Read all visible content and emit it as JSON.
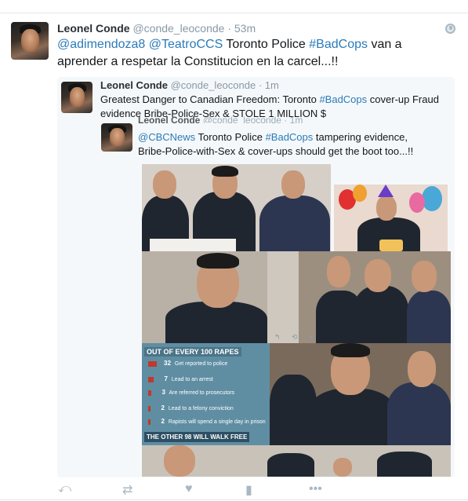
{
  "tweet": {
    "author_name": "Leonel Conde",
    "author_handle": "@conde_leoconde",
    "separator": "·",
    "timestamp": "53m",
    "mention_1": "@adimendoza8",
    "mention_2": "@TeatroCCS",
    "text_part_1": "Toronto Police",
    "hashtag": "#BadCops",
    "text_part_2": "van a aprender a respetar la Constitucion  en la carcel...!!",
    "privacy_icon": "globe-icon"
  },
  "quote_1": {
    "author_name": "Leonel Conde",
    "author_handle": "@conde_leoconde",
    "separator": "·",
    "timestamp": "1m",
    "text_part_1": "Greatest Danger to Canadian Freedom: Toronto",
    "hashtag": "#BadCops",
    "text_part_2": "cover-up Fraud evidence Bribe-Police-Sex & STOLE 1 MILLION $"
  },
  "quote_2": {
    "author_name": "Leonel Conde",
    "author_handle": "@conde_leoconde",
    "separator": "·",
    "timestamp": "1m",
    "mention": "@CBCNews",
    "text_part_1": "Toronto Police",
    "hashtag": "#BadCops",
    "text_part_2": "tampering evidence, Bribe-Police-with-Sex & cover-ups should get the boot too...!!"
  },
  "infographic": {
    "title": "OUT OF EVERY 100 RAPES",
    "rows": [
      {
        "num": "32",
        "label": "Get reported to police",
        "fraction": 0.78
      },
      {
        "num": "7",
        "label": "Lead to an arrest",
        "fraction": 0.5
      },
      {
        "num": "3",
        "label": "Are referred to prosecutors",
        "fraction": 0.3
      },
      {
        "num": "2",
        "label": "Lead to a felony conviction",
        "fraction": 0.2
      },
      {
        "num": "2",
        "label": "Rapists will spend a single day in prison",
        "fraction": 0.2
      }
    ],
    "footer": "THE OTHER 98 WILL WALK FREE"
  },
  "media_actions": "↰ ⟲ ♥",
  "actions": {
    "reply": "⤺",
    "retweet": "⇄",
    "like": "♥",
    "analytics": "▮",
    "more": "•••"
  },
  "colors": {
    "link": "#2b7bb9",
    "handle": "#8899a6",
    "action": "#aab8c2",
    "quote_bg": "#f5f8fa"
  }
}
